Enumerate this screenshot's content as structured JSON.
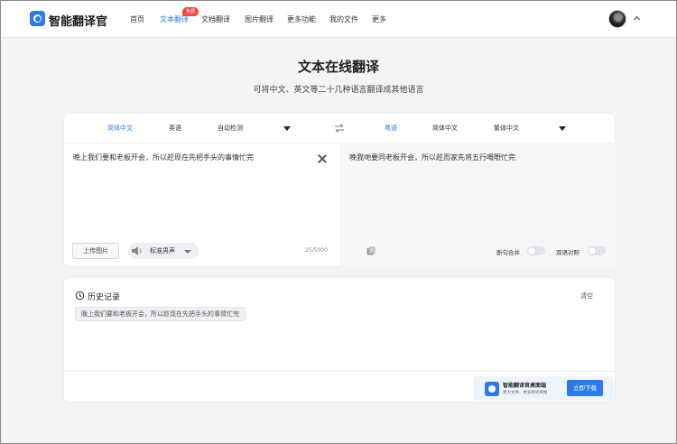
{
  "nav": {
    "brand": "智能翻译官",
    "items": [
      "首页",
      "文本翻译",
      "文档翻译",
      "图片翻译",
      "更多功能",
      "我的文件",
      "更多"
    ],
    "badge": "免费"
  },
  "header": {
    "title": "文本在线翻译",
    "subtitle": "可将中文、英文等二十几种语言翻译成其他语言"
  },
  "translator": {
    "source_langs": [
      "简体中文",
      "英语",
      "自动检测"
    ],
    "target_langs": [
      "粤语",
      "简体中文",
      "繁体中文"
    ],
    "source_text": "晚上我们要和老板开会，所以趁现在先把手头的事情忙完",
    "target_text": "晚我哋要同老板开会，所以趁而家先将五行嘅嘢忙完",
    "upload_label": "上传图片",
    "voice_label": "标准男声",
    "char_count": "25/5000",
    "toggle_sentence": "断句合并",
    "toggle_bilingual": "双语对照"
  },
  "history": {
    "title": "历史记录",
    "clear_label": "清空",
    "items": [
      "晚上我们要和老板开会，所以趁现在先把手头的事情忙完"
    ]
  },
  "promo": {
    "title": "智能翻译官桌面端",
    "subtitle": "更大文件、更多格式转换",
    "button": "立即下载"
  },
  "colors": {
    "accent": "#2b7ae8",
    "badge": "#f04a3e",
    "bg": "#f3f4f6"
  }
}
